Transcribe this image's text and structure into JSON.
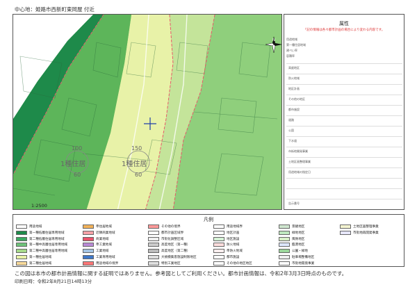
{
  "header": {
    "center_label": "中心地：姫路市西新町東岡屋 付近"
  },
  "attributes": {
    "title": "属性",
    "warning": "「記の情報は各々都市計画の場合により変わる内容です。",
    "rows": [
      "用途地域",
      "第一種住居地域",
      "建ぺい率",
      "容積率",
      "高度地区",
      "防火地域",
      "地区計画",
      "その他の地区",
      "都市施設",
      "道路",
      "公園",
      "下水道",
      "市街地開発事業",
      "土地区画整理事業",
      "用途地域の指定日",
      "告示番号"
    ]
  },
  "map": {
    "zone_labels": [
      "1種住居",
      "1種住居"
    ],
    "number_labels": [
      "100",
      "60",
      "150",
      "60"
    ],
    "scale": "1:2500",
    "compass": "N"
  },
  "legend": {
    "title": "凡例",
    "items": [
      {
        "label": "用途地域",
        "color": "#ffffff"
      },
      {
        "label": "第一種低層住居専用地域",
        "color": "#1e8a4a"
      },
      {
        "label": "第二種低層住居専用地域",
        "color": "#3aa860"
      },
      {
        "label": "第一種中高層住居専用地域",
        "color": "#6fc27a"
      },
      {
        "label": "第二種中高層住居専用地域",
        "color": "#a6d98a"
      },
      {
        "label": "第一種住居地域",
        "color": "#e8f2a8"
      },
      {
        "label": "第二種住居地域",
        "color": "#f7d99a"
      },
      {
        "label": "準住居地域",
        "color": "#f2b25a"
      },
      {
        "label": "近隣商業地域",
        "color": "#f4a2a8"
      },
      {
        "label": "商業地域",
        "color": "#e8526a"
      },
      {
        "label": "準工業地域",
        "color": "#b98ad6"
      },
      {
        "label": "工業地域",
        "color": "#a4c4e4"
      },
      {
        "label": "工業専用地域",
        "color": "#3e78c9"
      },
      {
        "label": "用途地域の境界",
        "color": "#ff7777"
      },
      {
        "label": "その他の境界",
        "color": "#ff9999"
      },
      {
        "label": "都市計画区域界",
        "color": "#ffffff"
      },
      {
        "label": "市街化調整区域",
        "color": "#eeeeee"
      },
      {
        "label": "高度地区（第一種）",
        "color": "#cccccc"
      },
      {
        "label": "高度地区（第二種）",
        "color": "#bbbbbb"
      },
      {
        "label": "大規模集客施設制限地区",
        "color": "#dddddd"
      },
      {
        "label": "特別工業地区",
        "color": "#e0e0e0"
      },
      {
        "label": "用途地域界",
        "color": "#ffffff"
      },
      {
        "label": "地区計画",
        "color": "#ffffff"
      },
      {
        "label": "地区施設",
        "color": "#d6f2d6"
      },
      {
        "label": "防火地域",
        "color": "#ffdddd"
      },
      {
        "label": "準防火地域",
        "color": "#ffeeee"
      },
      {
        "label": "都市施設",
        "color": "#ffffff"
      },
      {
        "label": "その他の地区地区",
        "color": "#ffffff"
      },
      {
        "label": "景観地区",
        "color": "#cfe6cf"
      },
      {
        "label": "緑地地区",
        "color": "#bfe8bf"
      },
      {
        "label": "風致地区",
        "color": "#d8f0c8"
      },
      {
        "label": "臨港地区",
        "color": "#dde7ff"
      },
      {
        "label": "公園・緑地",
        "color": "#9bd69b"
      },
      {
        "label": "駐車場整備地区",
        "color": "#eeeeee"
      },
      {
        "label": "市街地開発事業",
        "color": "#ffffff"
      },
      {
        "label": "土地区画整理事業",
        "color": "#f3f3d0"
      },
      {
        "label": "市街地再開発事業",
        "color": "#e7e7ff"
      }
    ]
  },
  "footer": {
    "notice": "この図は本市の都市計画情報に関する証明ではありません。参考図としてご利用ください。都市計画情報は、令和2年3月3日時点のものです。",
    "print_date": "印刷日時：令和2年8月21日14時13分"
  }
}
